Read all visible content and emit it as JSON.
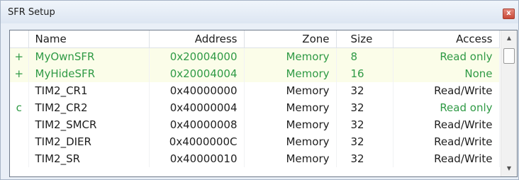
{
  "window": {
    "title": "SFR Setup",
    "close_glyph": "x"
  },
  "table": {
    "columns": [
      "",
      "Name",
      "Address",
      "Zone",
      "Size",
      "Access"
    ],
    "rows": [
      {
        "flag": "+",
        "name": "MyOwnSFR",
        "address": "0x20004000",
        "zone": "Memory",
        "size": "8",
        "access": "Read only",
        "kind": "custom"
      },
      {
        "flag": "+",
        "name": "MyHideSFR",
        "address": "0x20004004",
        "zone": "Memory",
        "size": "16",
        "access": "None",
        "kind": "custom"
      },
      {
        "flag": "",
        "name": "TIM2_CR1",
        "address": "0x40000000",
        "zone": "Memory",
        "size": "32",
        "access": "Read/Write",
        "kind": "normal"
      },
      {
        "flag": "c",
        "name": "TIM2_CR2",
        "address": "0x40000004",
        "zone": "Memory",
        "size": "32",
        "access": "Read only",
        "kind": "changed"
      },
      {
        "flag": "",
        "name": "TIM2_SMCR",
        "address": "0x40000008",
        "zone": "Memory",
        "size": "32",
        "access": "Read/Write",
        "kind": "normal"
      },
      {
        "flag": "",
        "name": "TIM2_DIER",
        "address": "0x4000000C",
        "zone": "Memory",
        "size": "32",
        "access": "Read/Write",
        "kind": "normal"
      },
      {
        "flag": "",
        "name": "TIM2_SR",
        "address": "0x40000010",
        "zone": "Memory",
        "size": "32",
        "access": "Read/Write",
        "kind": "normal"
      }
    ]
  },
  "scrollbar": {
    "up_glyph": "▲",
    "down_glyph": "▼"
  },
  "colors": {
    "custom_text": "#2f9a45",
    "custom_row_background": "#fbfde9"
  }
}
